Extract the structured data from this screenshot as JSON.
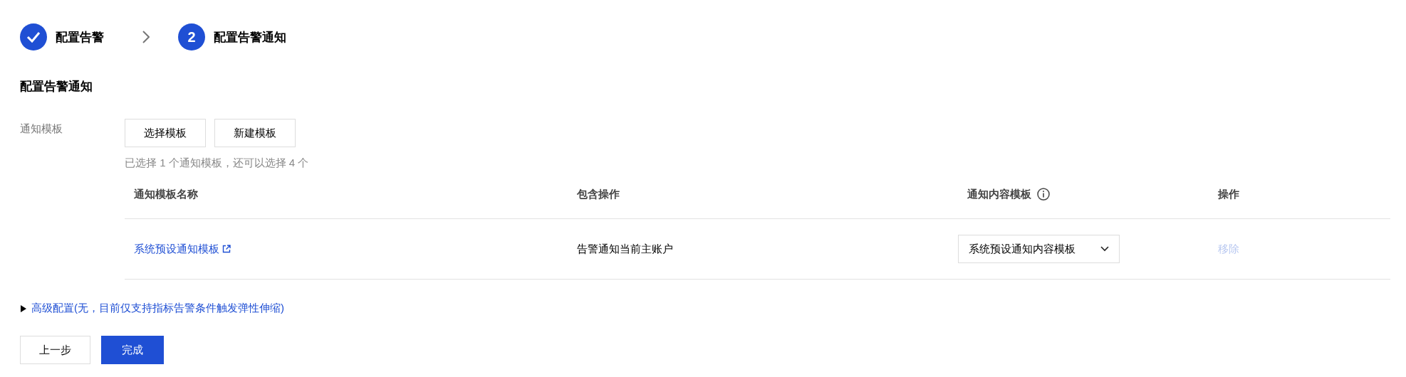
{
  "steps": [
    {
      "label": "配置告警",
      "done": true
    },
    {
      "number": "2",
      "label": "配置告警通知",
      "done": false
    }
  ],
  "section_title": "配置告警通知",
  "template_field": {
    "label": "通知模板",
    "buttons": [
      "选择模板",
      "新建模板"
    ],
    "hint": "已选择 1 个通知模板，还可以选择 4 个"
  },
  "table": {
    "columns": [
      {
        "label": "通知模板名称",
        "info": false
      },
      {
        "label": "包含操作",
        "info": false
      },
      {
        "label": "通知内容模板",
        "info": true
      },
      {
        "label": "操作",
        "info": false
      }
    ],
    "rows": [
      {
        "name": "系统预设通知模板",
        "operations": "告警通知当前主账户",
        "content_template": "系统预设通知内容模板",
        "action": "移除",
        "action_disabled": true
      }
    ]
  },
  "advanced": {
    "label": "高级配置(无，目前仅支持指标告警条件触发弹性伸缩)",
    "expanded": false
  },
  "footer_buttons": [
    {
      "label": "上一步",
      "kind": "default"
    },
    {
      "label": "完成",
      "kind": "primary"
    }
  ]
}
